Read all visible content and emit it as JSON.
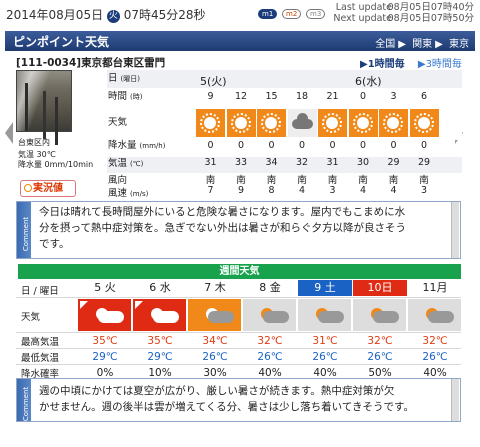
{
  "top": {
    "date_ym": "2014年08月05日",
    "weekday": "火",
    "time": "07時45分28秒",
    "badges": [
      "m1",
      "m2",
      "m3"
    ],
    "last_update_label": "Last update",
    "last_update": "08月05日07時40分",
    "next_update_label": "Next update",
    "next_update": "08月05日07時50分"
  },
  "title": {
    "text": "ピンポイント天気",
    "crumbs": [
      "全国",
      "関東",
      "東京"
    ]
  },
  "location": {
    "text": "[111-0034]東京都台東区雷門",
    "tab_hourly": "1時間毎",
    "tab_3hourly": "3時間毎"
  },
  "station": {
    "name": "台東区内",
    "temp_label": "気温",
    "temp": "30℃",
    "rain_label": "降水量",
    "rain": "0mm/10min",
    "button": "実況値"
  },
  "hourly": {
    "row_labels": {
      "date": "日",
      "date_sub": "(曜日)",
      "time": "時間",
      "time_sub": "(時)",
      "weather": "天気",
      "rain": "降水量",
      "rain_sub": "(mm/h)",
      "temp": "気温",
      "temp_sub": "(℃)",
      "wind": "風向",
      "wind2": "風速",
      "wind_sub": "(m/s)"
    },
    "days": [
      "5(火)",
      "6(水)"
    ],
    "times": [
      "9",
      "12",
      "15",
      "18",
      "21",
      "0",
      "3",
      "6"
    ],
    "weather": [
      "sun",
      "sun",
      "sun",
      "cloud",
      "sun",
      "sun",
      "sun",
      "sun"
    ],
    "rain": [
      "0",
      "0",
      "0",
      "0",
      "0",
      "0",
      "0",
      "0"
    ],
    "temp": [
      "31",
      "33",
      "34",
      "32",
      "31",
      "30",
      "29",
      "29"
    ],
    "wind_dir": [
      "南",
      "南",
      "南",
      "南",
      "南",
      "南",
      "南",
      "南"
    ],
    "wind_speed": [
      "7",
      "9",
      "8",
      "4",
      "3",
      "4",
      "4",
      "3"
    ]
  },
  "comment1": {
    "label": "Comment",
    "lines": [
      "今日は晴れて長時間屋外にいると危険な暑さになります。屋内でもこまめに水",
      "分を摂って熱中症対策を。急ぎでない外出は暑さが和らぐ夕方以降が良さそう",
      "です。"
    ]
  },
  "weekly": {
    "title": "週間天気",
    "labels": {
      "date": "日 / 曜日",
      "weather": "天気",
      "max": "最高気温",
      "min": "最低気温",
      "pop": "降水確率"
    },
    "days": [
      "5 火",
      "6 水",
      "7 木",
      "8 金",
      "9 土",
      "10日",
      "11月"
    ],
    "icons": [
      "red",
      "red",
      "ora",
      "gry",
      "gry",
      "gry",
      "gry"
    ],
    "max": [
      "35℃",
      "35℃",
      "34℃",
      "32℃",
      "31℃",
      "32℃",
      "32℃"
    ],
    "min": [
      "29℃",
      "29℃",
      "26℃",
      "26℃",
      "26℃",
      "26℃",
      "26℃"
    ],
    "pop": [
      "0%",
      "10%",
      "30%",
      "40%",
      "40%",
      "50%",
      "40%"
    ]
  },
  "comment2": {
    "label": "Comment",
    "lines": [
      "週の中頃にかけては夏空が広がり、厳しい暑さが続きます。熱中症対策が欠",
      "かせません。週の後半は雲が増えてくる分、暑さは少し落ち着いてきそうです。"
    ]
  },
  "colors": {
    "title_bar": "#1d3a72",
    "accent_orange": "#f0891a",
    "hot_red": "#e02b14",
    "week_green": "#18a24d",
    "sat_blue": "#1a62c4"
  }
}
